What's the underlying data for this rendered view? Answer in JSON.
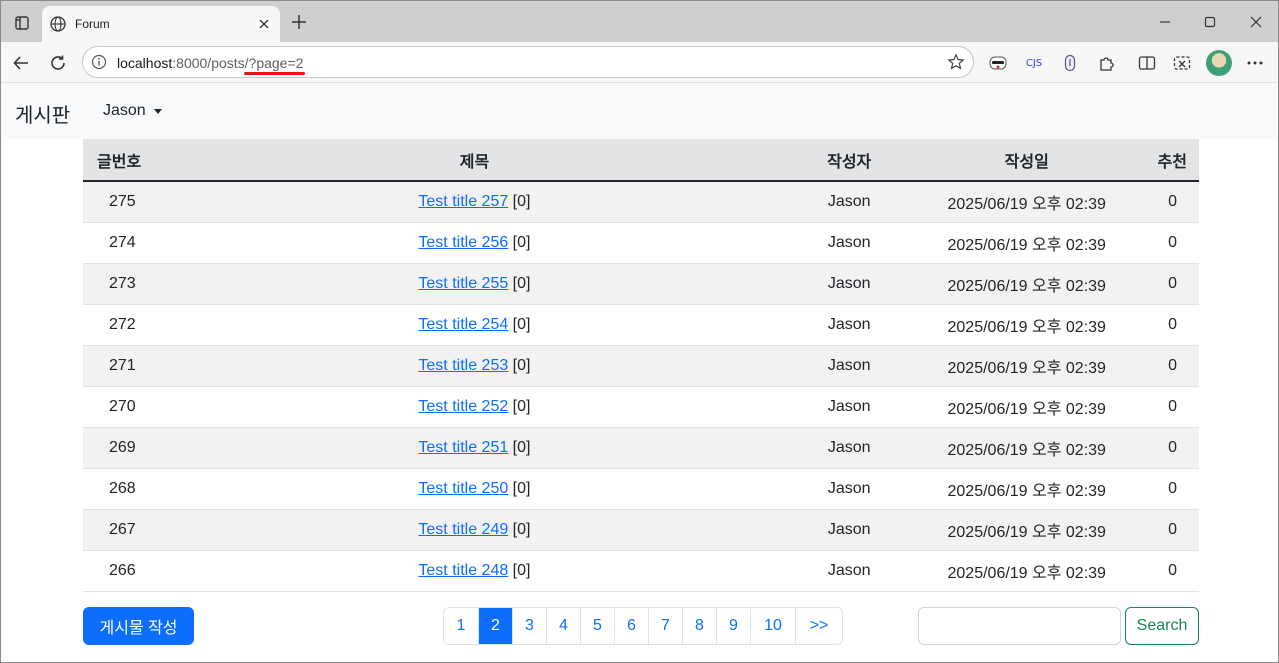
{
  "browser": {
    "tab_title": "Forum",
    "url_host": "localhost",
    "url_rest": ":8000/posts/?page=2",
    "icons": [
      "tab-actions-icon",
      "globe-icon",
      "close-icon",
      "plus-icon",
      "minimize-icon",
      "maximize-icon",
      "window-close-icon",
      "back-icon",
      "reload-icon",
      "info-icon",
      "star-icon",
      "incognito-icon",
      "cjs-extension-icon",
      "extension-icon",
      "puzzle-icon",
      "split-screen-icon",
      "screenshot-icon",
      "more-icon"
    ],
    "cjs_label": "CJS"
  },
  "navbar": {
    "brand": "게시판",
    "user": "Jason"
  },
  "table": {
    "headers": {
      "num": "글번호",
      "title": "제목",
      "author": "작성자",
      "date": "작성일",
      "rec": "추천"
    },
    "rows": [
      {
        "num": "275",
        "title": "Test title 257",
        "comments": " [0]",
        "author": "Jason",
        "date": "2025/06/19 오후 02:39",
        "rec": "0"
      },
      {
        "num": "274",
        "title": "Test title 256",
        "comments": " [0]",
        "author": "Jason",
        "date": "2025/06/19 오후 02:39",
        "rec": "0"
      },
      {
        "num": "273",
        "title": "Test title 255",
        "comments": " [0]",
        "author": "Jason",
        "date": "2025/06/19 오후 02:39",
        "rec": "0"
      },
      {
        "num": "272",
        "title": "Test title 254",
        "comments": " [0]",
        "author": "Jason",
        "date": "2025/06/19 오후 02:39",
        "rec": "0"
      },
      {
        "num": "271",
        "title": "Test title 253",
        "comments": " [0]",
        "author": "Jason",
        "date": "2025/06/19 오후 02:39",
        "rec": "0"
      },
      {
        "num": "270",
        "title": "Test title 252",
        "comments": " [0]",
        "author": "Jason",
        "date": "2025/06/19 오후 02:39",
        "rec": "0"
      },
      {
        "num": "269",
        "title": "Test title 251",
        "comments": " [0]",
        "author": "Jason",
        "date": "2025/06/19 오후 02:39",
        "rec": "0"
      },
      {
        "num": "268",
        "title": "Test title 250",
        "comments": " [0]",
        "author": "Jason",
        "date": "2025/06/19 오후 02:39",
        "rec": "0"
      },
      {
        "num": "267",
        "title": "Test title 249",
        "comments": " [0]",
        "author": "Jason",
        "date": "2025/06/19 오후 02:39",
        "rec": "0"
      },
      {
        "num": "266",
        "title": "Test title 248",
        "comments": " [0]",
        "author": "Jason",
        "date": "2025/06/19 오후 02:39",
        "rec": "0"
      }
    ]
  },
  "footer": {
    "write_button": "게시물 작성",
    "pages": [
      "1",
      "2",
      "3",
      "4",
      "5",
      "6",
      "7",
      "8",
      "9",
      "10",
      ">>"
    ],
    "active_page": "2",
    "search_value": "",
    "search_button": "Search"
  },
  "colors": {
    "primary": "#0d6efd",
    "success": "#198754",
    "annotation_underline": "#e01818"
  }
}
